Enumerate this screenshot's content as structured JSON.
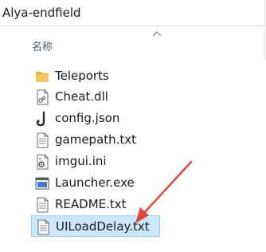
{
  "window": {
    "address": "Alya-endfield"
  },
  "header": {
    "name_column": "名称"
  },
  "files": [
    {
      "name": "Teleports",
      "icon": "folder-icon"
    },
    {
      "name": "Cheat.dll",
      "icon": "dll-file-icon"
    },
    {
      "name": "config.json",
      "icon": "json-file-icon"
    },
    {
      "name": "gamepath.txt",
      "icon": "text-file-icon"
    },
    {
      "name": "imgui.ini",
      "icon": "ini-file-icon"
    },
    {
      "name": "Launcher.exe",
      "icon": "exe-file-icon"
    },
    {
      "name": "README.txt",
      "icon": "text-file-icon"
    },
    {
      "name": "UILoadDelay.txt",
      "icon": "text-file-icon",
      "selected": true
    }
  ],
  "annotation": {
    "arrow_color": "#e8443a"
  },
  "colors": {
    "selection_bg": "#cce8ff",
    "selection_border": "#99d1ff",
    "folder": "#f6c55b"
  }
}
